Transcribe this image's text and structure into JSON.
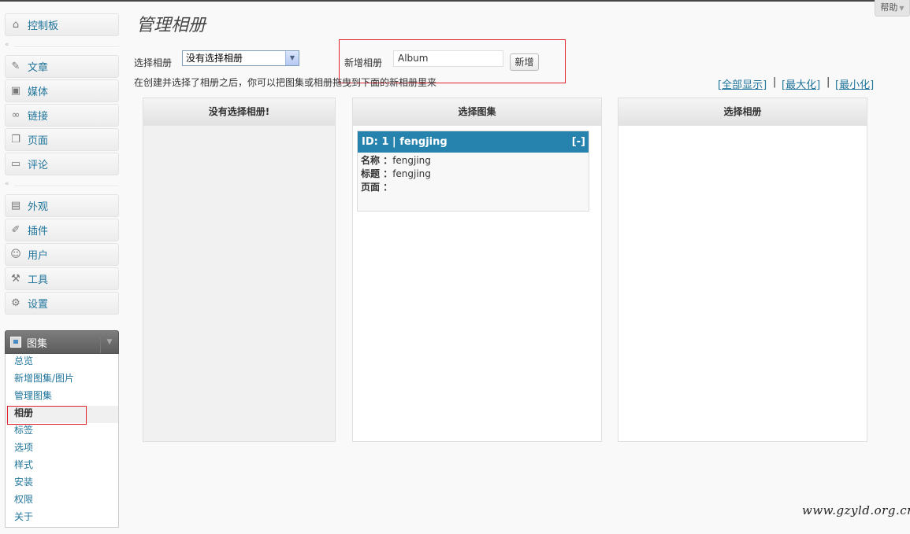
{
  "help": {
    "label": "帮助"
  },
  "sidebar": {
    "dashboard": "控制板",
    "group1": [
      {
        "label": "文章",
        "icon": "pushpin-icon"
      },
      {
        "label": "媒体",
        "icon": "media-icon"
      },
      {
        "label": "链接",
        "icon": "link-icon"
      },
      {
        "label": "页面",
        "icon": "pages-icon"
      },
      {
        "label": "评论",
        "icon": "comment-icon"
      }
    ],
    "group2": [
      {
        "label": "外观",
        "icon": "appearance-icon"
      },
      {
        "label": "插件",
        "icon": "plugin-icon"
      },
      {
        "label": "用户",
        "icon": "users-icon"
      },
      {
        "label": "工具",
        "icon": "tools-icon"
      },
      {
        "label": "设置",
        "icon": "settings-icon"
      }
    ],
    "gallery": {
      "label": "图集",
      "items": [
        "总览",
        "新增图集/图片",
        "管理图集",
        "相册",
        "标签",
        "选项",
        "样式",
        "安装",
        "权限",
        "关于"
      ],
      "current": "相册"
    }
  },
  "main": {
    "title": "管理相册",
    "select_label": "选择相册",
    "select_value": "没有选择相册",
    "new_label": "新增相册",
    "new_value": "Album",
    "new_button": "新增",
    "hint": "在创建并选择了相册之后，你可以把图集或相册拖曳到下面的新相册里来",
    "view_links": [
      "[全部显示]",
      "[最大化]",
      "[最小化]"
    ],
    "view_sep": "|",
    "panels": {
      "left": {
        "title": "没有选择相册!"
      },
      "middle": {
        "title": "选择图集",
        "card": {
          "head": "ID: 1 | fengjing",
          "collapse": "[-]",
          "rows": [
            {
              "key": "名称 ：",
              "value": "fengjing"
            },
            {
              "key": "标题 ：",
              "value": "fengjing"
            },
            {
              "key": "页面 ：",
              "value": ""
            }
          ]
        }
      },
      "right": {
        "title": "选择相册"
      }
    }
  },
  "watermark": "www.gzyld.org.cn"
}
